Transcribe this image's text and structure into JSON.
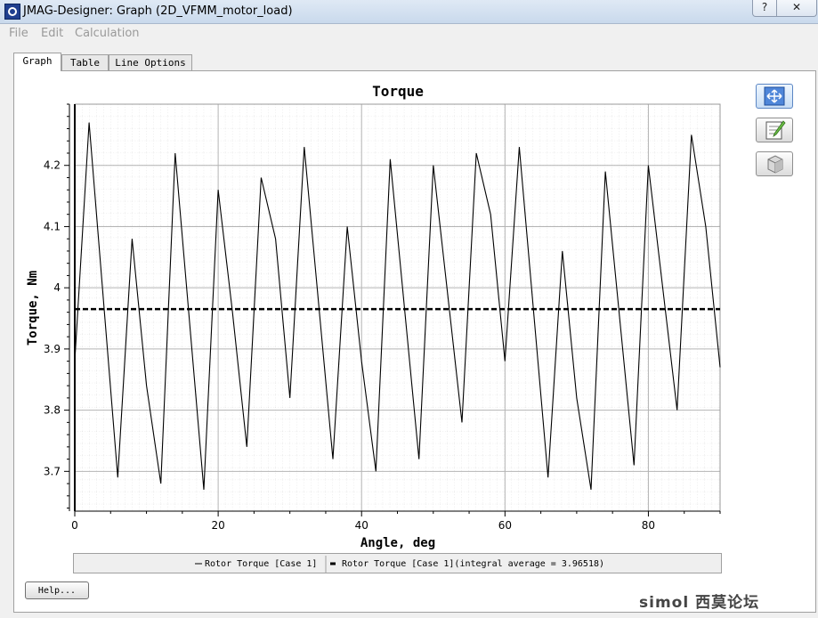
{
  "window": {
    "title": "JMAG-Designer: Graph (2D_VFMM_motor_load)",
    "help_label": "?",
    "close_label": "✕"
  },
  "menu": [
    "File",
    "Edit",
    "Calculation"
  ],
  "tabs": [
    {
      "label": "Graph",
      "active": true
    },
    {
      "label": "Table",
      "active": false
    },
    {
      "label": "Line Options",
      "active": false
    }
  ],
  "side_buttons": [
    {
      "icon": "fit-view-icon"
    },
    {
      "icon": "edit-notepad-icon"
    },
    {
      "icon": "box-3d-icon"
    }
  ],
  "chart_data": {
    "type": "line",
    "title": "Torque",
    "xlabel": "Angle, deg",
    "ylabel": "Torque, Nm",
    "xlim": [
      0,
      90
    ],
    "ylim": [
      3.635,
      4.3
    ],
    "x_ticks": [
      0,
      20,
      40,
      60,
      80
    ],
    "y_ticks": [
      3.7,
      3.8,
      3.9,
      4.0,
      4.1,
      4.2
    ],
    "y_tick_labels": [
      "3.7",
      "3.8",
      "3.9",
      "4",
      "4.1",
      "4.2"
    ],
    "grid": true,
    "series": [
      {
        "name": "Rotor Torque [Case 1]",
        "color": "#000000",
        "style": "solid",
        "x": [
          0,
          2,
          6,
          8,
          10,
          12,
          14,
          18,
          20,
          22,
          24,
          26,
          28,
          30,
          32,
          36,
          38,
          40,
          42,
          44,
          48,
          50,
          54,
          56,
          58,
          60,
          62,
          66,
          68,
          70,
          72,
          74,
          78,
          80,
          84,
          86,
          88,
          90
        ],
        "y": [
          3.88,
          4.27,
          3.69,
          4.08,
          3.84,
          3.68,
          4.22,
          3.67,
          4.16,
          3.96,
          3.74,
          4.18,
          4.08,
          3.82,
          4.23,
          3.72,
          4.1,
          3.88,
          3.7,
          4.21,
          3.72,
          4.2,
          3.78,
          4.22,
          4.12,
          3.88,
          4.23,
          3.69,
          4.06,
          3.82,
          3.67,
          4.19,
          3.71,
          4.2,
          3.8,
          4.25,
          4.1,
          3.87
        ]
      },
      {
        "name": "Rotor Torque [Case 1](integral average = 3.96518)",
        "color": "#000000",
        "style": "dashed",
        "x": [
          0,
          90
        ],
        "y": [
          3.96518,
          3.96518
        ]
      }
    ],
    "legend": [
      {
        "label": "Rotor Torque [Case 1]"
      },
      {
        "label": "Rotor Torque [Case 1](integral average = 3.96518)"
      }
    ],
    "legend_position": "bottom"
  },
  "buttons": {
    "help": "Help..."
  },
  "watermark": "simol 西莫论坛"
}
